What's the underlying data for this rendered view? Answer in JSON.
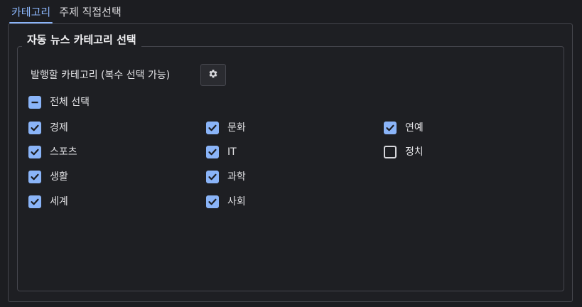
{
  "tabs": [
    {
      "label": "카테고리",
      "active": true
    },
    {
      "label": "주제 직접선택",
      "active": false
    }
  ],
  "group": {
    "title": "자동 뉴스 카테고리 선택",
    "publish_label": "발행할 카테고리 (복수 선택 가능)",
    "settings_icon": "gear-icon",
    "select_all": {
      "label": "전체 선택",
      "state": "partial"
    }
  },
  "categories": [
    {
      "label": "경제",
      "checked": true
    },
    {
      "label": "문화",
      "checked": true
    },
    {
      "label": "연예",
      "checked": true
    },
    {
      "label": "스포츠",
      "checked": true
    },
    {
      "label": "IT",
      "checked": true
    },
    {
      "label": "정치",
      "checked": false
    },
    {
      "label": "생활",
      "checked": true
    },
    {
      "label": "과학",
      "checked": true
    },
    {
      "label": "세계",
      "checked": true
    },
    {
      "label": "사회",
      "checked": true
    }
  ],
  "colors": {
    "accent": "#8ab4f8",
    "background": "#1e1f23",
    "border": "#45464d"
  }
}
